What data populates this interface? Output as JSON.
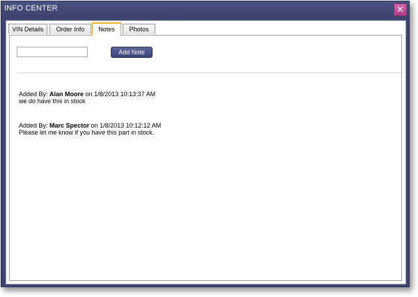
{
  "window": {
    "title": "INFO CENTER",
    "close_glyph": "✕"
  },
  "tabs": [
    {
      "label": "VIN Details",
      "active": false
    },
    {
      "label": "Order Info",
      "active": false
    },
    {
      "label": "Notes",
      "active": true
    },
    {
      "label": "Photos",
      "active": false
    }
  ],
  "notes_panel": {
    "input_value": "",
    "add_button_label": "Add Note",
    "notes": [
      {
        "prefix": "Added By:",
        "author": "Alan Moore",
        "on_label": "on",
        "timestamp": "1/8/2013 10:13:37 AM",
        "text": "we do have this in stock"
      },
      {
        "prefix": "Added By:",
        "author": "Marc Spector",
        "on_label": "on",
        "timestamp": "1/8/2013 10:12:12 AM",
        "text": "Please let me know if you have this part in stock."
      }
    ]
  },
  "colors": {
    "frame": "#3d4472",
    "close_button": "#c24c96",
    "active_tab_accent": "#f0b030",
    "button": "#3b4476"
  }
}
